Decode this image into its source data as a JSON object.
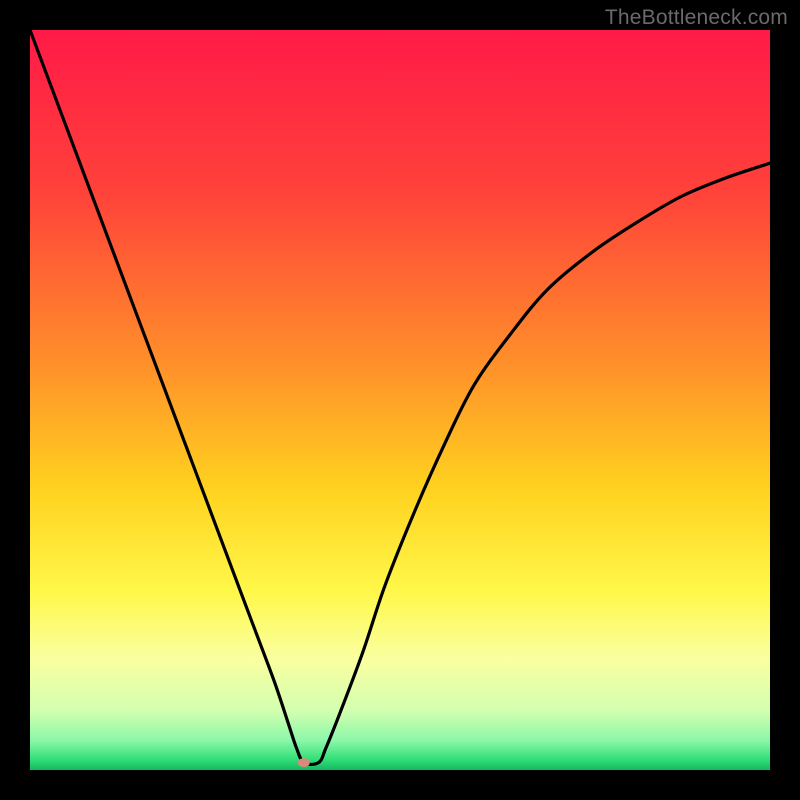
{
  "watermark": "TheBottleneck.com",
  "chart_data": {
    "type": "line",
    "title": "",
    "xlabel": "",
    "ylabel": "",
    "xlim": [
      0,
      100
    ],
    "ylim": [
      0,
      100
    ],
    "gradient_stops": [
      {
        "offset": 0,
        "color": "#ff1a47"
      },
      {
        "offset": 0.22,
        "color": "#ff423a"
      },
      {
        "offset": 0.45,
        "color": "#ff8f2a"
      },
      {
        "offset": 0.62,
        "color": "#ffd21f"
      },
      {
        "offset": 0.76,
        "color": "#fff84a"
      },
      {
        "offset": 0.85,
        "color": "#faffa0"
      },
      {
        "offset": 0.92,
        "color": "#d2ffb0"
      },
      {
        "offset": 0.96,
        "color": "#8cf7a8"
      },
      {
        "offset": 0.985,
        "color": "#33e07a"
      },
      {
        "offset": 1.0,
        "color": "#14b85e"
      }
    ],
    "series": [
      {
        "name": "bottleneck-curve",
        "x": [
          0,
          3,
          6,
          9,
          12,
          15,
          18,
          21,
          24,
          27,
          30,
          33,
          35,
          36,
          37,
          39,
          40,
          42,
          45,
          48,
          52,
          56,
          60,
          65,
          70,
          76,
          82,
          88,
          94,
          100
        ],
        "y": [
          100,
          92,
          84,
          76,
          68,
          60,
          52,
          44,
          36,
          28,
          20,
          12,
          6,
          3,
          1,
          1,
          3,
          8,
          16,
          25,
          35,
          44,
          52,
          59,
          65,
          70,
          74,
          77.5,
          80,
          82
        ]
      }
    ],
    "marker": {
      "x": 37,
      "y": 1,
      "color": "#d98b7a",
      "rx": 6,
      "ry": 4.5
    },
    "line_color": "#000000",
    "line_width": 3.2
  }
}
